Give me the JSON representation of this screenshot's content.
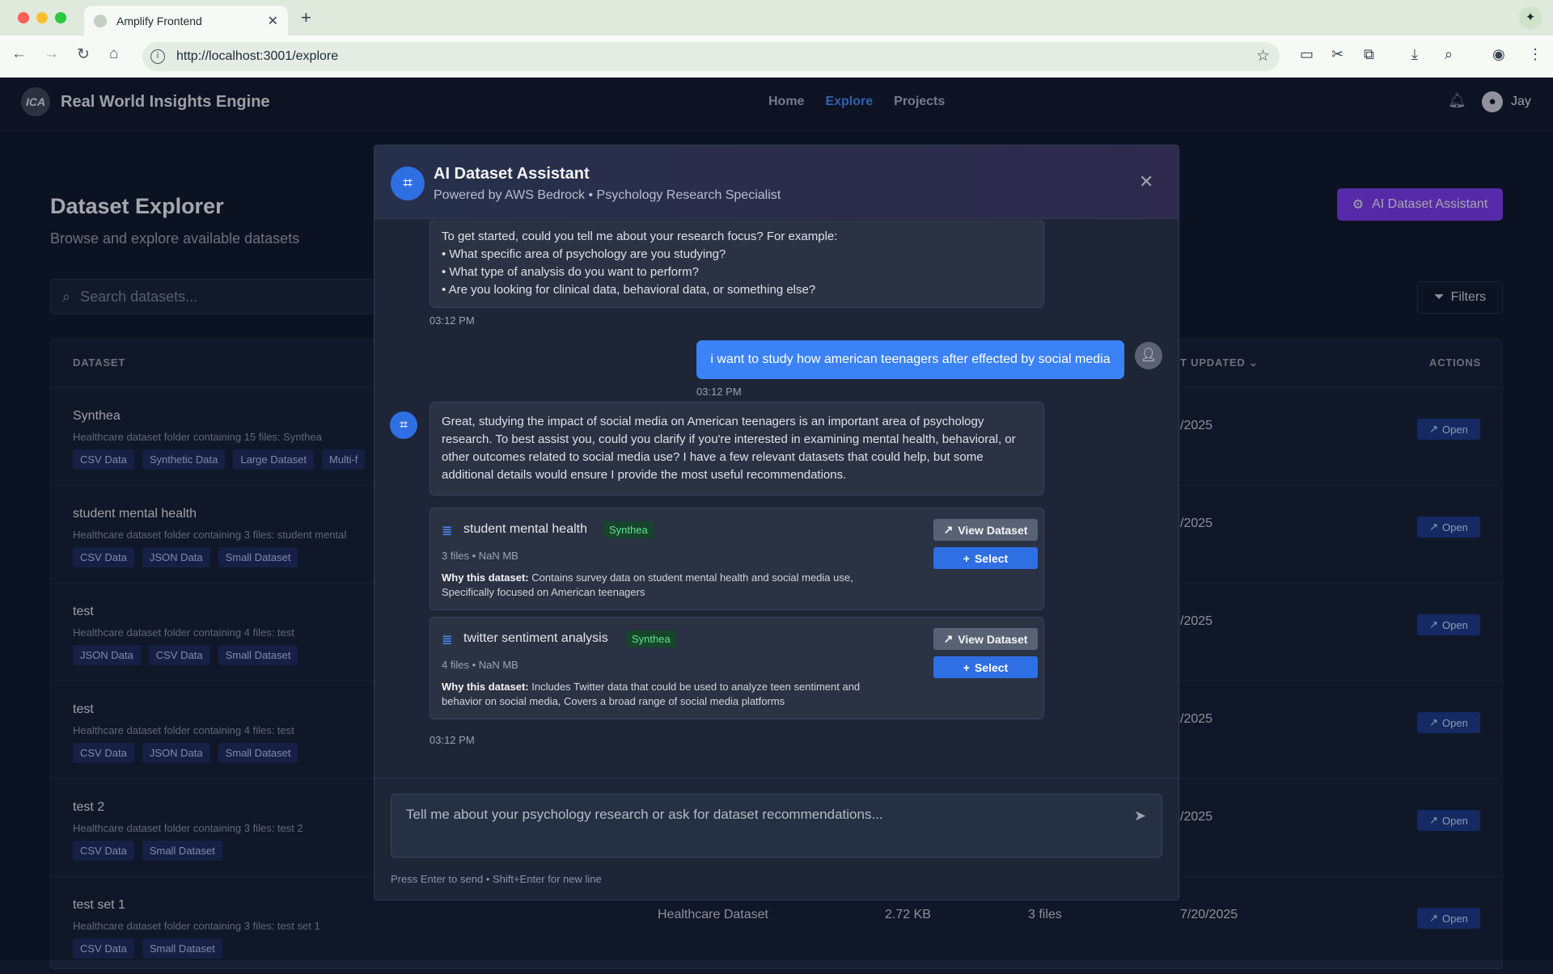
{
  "browser": {
    "tab_title": "Amplify Frontend",
    "url": "http://localhost:3001/explore"
  },
  "app": {
    "brand": "Real World Insights Engine",
    "logo_text": "ICA",
    "nav": [
      "Home",
      "Explore",
      "Projects"
    ],
    "active_nav": "Explore",
    "user": "Jay"
  },
  "page": {
    "title": "Dataset Explorer",
    "subtitle": "Browse and explore available datasets",
    "ai_button": "AI Dataset Assistant",
    "search_placeholder": "Search datasets...",
    "filters_label": "Filters",
    "columns": {
      "dataset": "DATASET",
      "last_updated": "T UPDATED",
      "actions": "ACTIONS"
    },
    "rows": [
      {
        "name": "Synthea",
        "desc": "Healthcare dataset folder containing 15 files: Synthea",
        "tags": [
          "CSV Data",
          "Synthetic Data",
          "Large Dataset",
          "Multi-f"
        ],
        "date": "/2025",
        "action": "Open"
      },
      {
        "name": "student mental health",
        "desc": "Healthcare dataset folder containing 3 files: student mental",
        "tags": [
          "CSV Data",
          "JSON Data",
          "Small Dataset"
        ],
        "date": "/2025",
        "action": "Open"
      },
      {
        "name": "test",
        "desc": "Healthcare dataset folder containing 4 files: test",
        "tags": [
          "JSON Data",
          "CSV Data",
          "Small Dataset"
        ],
        "date": "/2025",
        "action": "Open"
      },
      {
        "name": "test",
        "desc": "Healthcare dataset folder containing 4 files: test",
        "tags": [
          "CSV Data",
          "JSON Data",
          "Small Dataset"
        ],
        "date": "/2025",
        "action": "Open"
      },
      {
        "name": "test 2",
        "desc": "Healthcare dataset folder containing 3 files: test 2",
        "tags": [
          "CSV Data",
          "Small Dataset"
        ],
        "date": "/2025",
        "action": "Open"
      },
      {
        "name": "test set 1",
        "desc": "Healthcare dataset folder containing 3 files: test set 1",
        "tags": [
          "CSV Data",
          "Small Dataset"
        ],
        "type": "Healthcare Dataset",
        "size": "2.72 KB",
        "files": "3 files",
        "date": "7/20/2025",
        "action": "Open"
      }
    ]
  },
  "modal": {
    "title": "AI Dataset Assistant",
    "subtitle": "Powered by AWS Bedrock • Psychology Research Specialist",
    "messages": {
      "bot1_lines": [
        "To get started, could you tell me about your research focus? For example:",
        "• What specific area of psychology are you studying?",
        "• What type of analysis do you want to perform?",
        "• Are you looking for clinical data, behavioral data, or something else?"
      ],
      "bot1_time": "03:12 PM",
      "user_text": "i want to study how american teenagers after effected by social media",
      "user_time": "03:12 PM",
      "bot2_text": "Great, studying the impact of social media on American teenagers is an important area of psychology research. To best assist you, could you clarify if you're interested in examining mental health, behavioral, or other outcomes related to social media use? I have a few relevant datasets that could help, but some additional details would ensure I provide the most useful recommendations.",
      "bot2_time": "03:12 PM"
    },
    "recommendations": [
      {
        "name": "student mental health",
        "source": "Synthea",
        "meta": "3 files • NaN MB",
        "why_label": "Why this dataset:",
        "why": "Contains survey data on student mental health and social media use, Specifically focused on American teenagers",
        "view": "View Dataset",
        "select": "Select"
      },
      {
        "name": "twitter sentiment analysis",
        "source": "Synthea",
        "meta": "4 files • NaN MB",
        "why_label": "Why this dataset:",
        "why": "Includes Twitter data that could be used to analyze teen sentiment and behavior on social media, Covers a broad range of social media platforms",
        "view": "View Dataset",
        "select": "Select"
      }
    ],
    "input_placeholder": "Tell me about your psychology research or ask for dataset recommendations...",
    "hint": "Press Enter to send • Shift+Enter for new line"
  }
}
